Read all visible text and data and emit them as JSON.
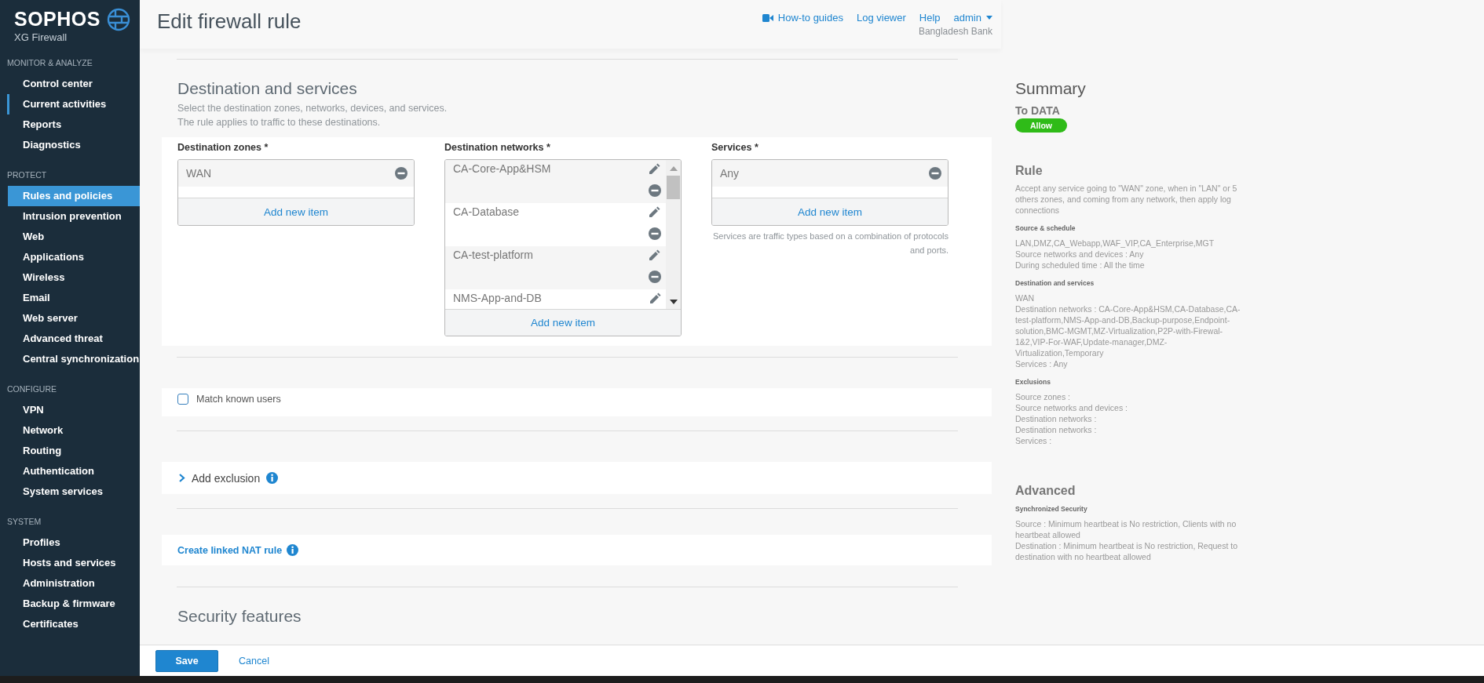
{
  "sidebar": {
    "logo": "SOPHOS",
    "product": "XG Firewall",
    "sections": [
      {
        "title": "MONITOR & ANALYZE",
        "items": [
          {
            "label": "Control center",
            "selected": false,
            "focused": false
          },
          {
            "label": "Current activities",
            "selected": false,
            "focused": true
          },
          {
            "label": "Reports",
            "selected": false,
            "focused": false
          },
          {
            "label": "Diagnostics",
            "selected": false,
            "focused": false
          }
        ]
      },
      {
        "title": "PROTECT",
        "items": [
          {
            "label": "Rules and policies",
            "selected": true,
            "focused": false
          },
          {
            "label": "Intrusion prevention",
            "selected": false,
            "focused": false
          },
          {
            "label": "Web",
            "selected": false,
            "focused": false
          },
          {
            "label": "Applications",
            "selected": false,
            "focused": false
          },
          {
            "label": "Wireless",
            "selected": false,
            "focused": false
          },
          {
            "label": "Email",
            "selected": false,
            "focused": false
          },
          {
            "label": "Web server",
            "selected": false,
            "focused": false
          },
          {
            "label": "Advanced threat",
            "selected": false,
            "focused": false
          },
          {
            "label": "Central synchronization",
            "selected": false,
            "focused": false
          }
        ]
      },
      {
        "title": "CONFIGURE",
        "items": [
          {
            "label": "VPN",
            "selected": false,
            "focused": false
          },
          {
            "label": "Network",
            "selected": false,
            "focused": false
          },
          {
            "label": "Routing",
            "selected": false,
            "focused": false
          },
          {
            "label": "Authentication",
            "selected": false,
            "focused": false
          },
          {
            "label": "System services",
            "selected": false,
            "focused": false
          }
        ]
      },
      {
        "title": "SYSTEM",
        "items": [
          {
            "label": "Profiles",
            "selected": false,
            "focused": false
          },
          {
            "label": "Hosts and services",
            "selected": false,
            "focused": false
          },
          {
            "label": "Administration",
            "selected": false,
            "focused": false
          },
          {
            "label": "Backup & firmware",
            "selected": false,
            "focused": false
          },
          {
            "label": "Certificates",
            "selected": false,
            "focused": false
          }
        ]
      }
    ]
  },
  "header": {
    "title": "Edit firewall rule",
    "links": [
      {
        "label": "How-to guides",
        "kind": "video"
      },
      {
        "label": "Log viewer",
        "kind": "plain"
      },
      {
        "label": "Help",
        "kind": "plain"
      },
      {
        "label": "admin",
        "kind": "dropdown"
      }
    ],
    "organization": "Bangladesh Bank"
  },
  "destination": {
    "title": "Destination and services",
    "description": [
      "Select the destination zones, networks, devices, and services.",
      "The rule applies to traffic to these destinations."
    ],
    "fields": [
      {
        "label": "Destination zones *",
        "kind": "simple",
        "items": [
          {
            "name": "WAN"
          }
        ],
        "add": "Add new item"
      },
      {
        "label": "Destination networks *",
        "kind": "scroll",
        "items": [
          {
            "name": "CA-Core-App&HSM"
          },
          {
            "name": "CA-Database"
          },
          {
            "name": "CA-test-platform"
          },
          {
            "name": "NMS-App-and-DB"
          }
        ],
        "add": "Add new item"
      },
      {
        "label": "Services *",
        "kind": "simple",
        "items": [
          {
            "name": "Any"
          }
        ],
        "add": "Add new item",
        "hint": "Services are traffic types based on a combination of protocols and ports."
      }
    ]
  },
  "match_users": {
    "label": "Match known users",
    "checked": false
  },
  "exclusion": {
    "label": "Add exclusion",
    "expanded": false
  },
  "nat_link": {
    "label": "Create linked NAT rule"
  },
  "next_section": {
    "title": "Security features"
  },
  "summary": {
    "title": "Summary",
    "rule_name": "To DATA",
    "action": "Allow",
    "blocks": [
      {
        "title": "Rule",
        "text": "Accept any service going to \"WAN\" zone, when in \"LAN\" or 5 others zones, and coming from any network, then apply log connections",
        "groups": [
          {
            "title": "Source & schedule",
            "lines": [
              "LAN,DMZ,CA_Webapp,WAF_VIP,CA_Enterprise,MGT",
              "Source networks and devices : Any",
              "During scheduled time : All the time"
            ]
          },
          {
            "title": "Destination and services",
            "lines": [
              "WAN",
              "Destination networks : CA-Core-App&HSM,CA-Database,CA-test-platform,NMS-App-and-DB,Backup-purpose,Endpoint-solution,BMC-MGMT,MZ-Virtualization,P2P-with-Firewal-1&2,VIP-For-WAF,Update-manager,DMZ-Virtualization,Temporary",
              "Services : Any"
            ]
          },
          {
            "title": "Exclusions",
            "lines": [
              "Source zones :",
              "Source networks and devices :",
              "Destination networks :",
              "Destination networks :",
              "Services :"
            ]
          }
        ]
      },
      {
        "title": "Advanced",
        "groups": [
          {
            "title": "Synchronized Security",
            "lines": [
              "Source : Minimum heartbeat is No restriction, Clients with no heartbeat allowed",
              "Destination : Minimum heartbeat is No restriction, Request to destination with no heartbeat allowed"
            ]
          }
        ]
      }
    ]
  },
  "footer": {
    "buttons": [
      {
        "label": "Save",
        "kind": "primary"
      },
      {
        "label": "Cancel",
        "kind": "link"
      }
    ]
  }
}
